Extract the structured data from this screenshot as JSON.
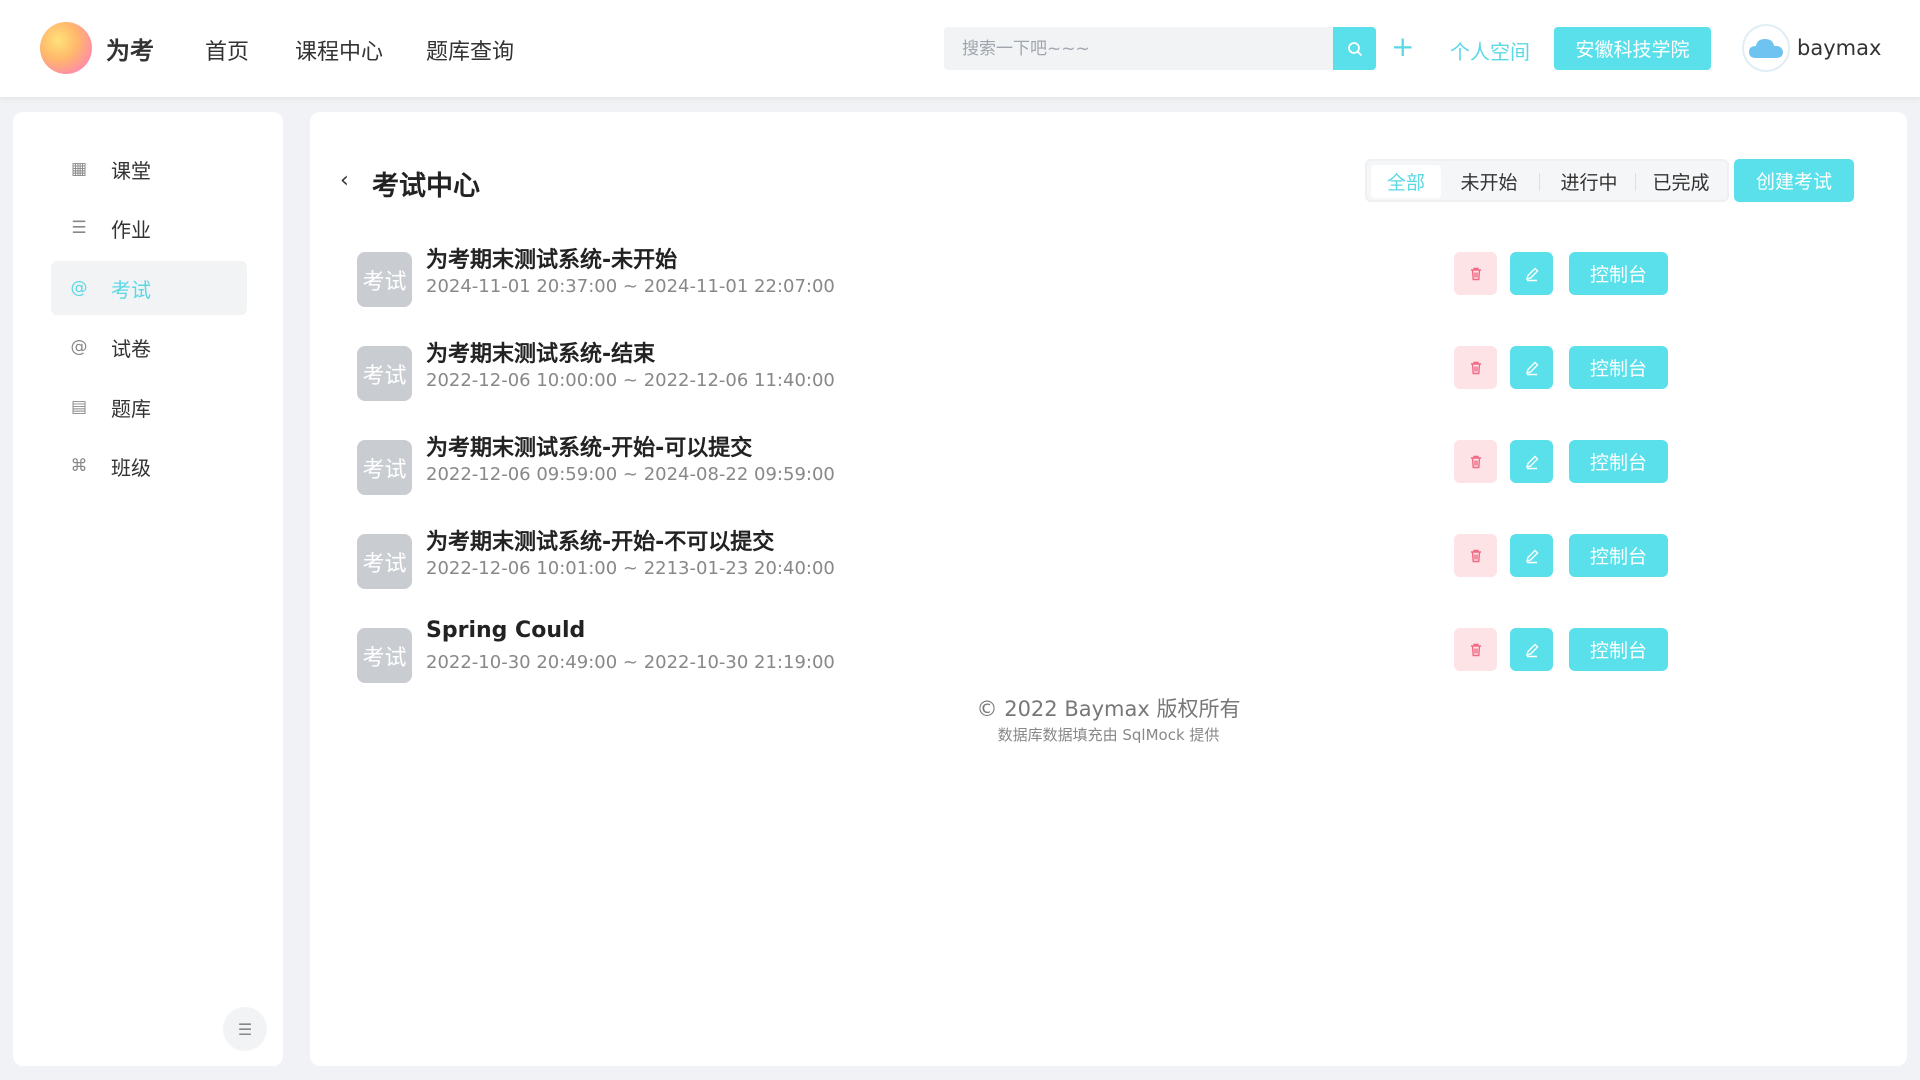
{
  "header": {
    "brand": "为考",
    "nav": [
      "首页",
      "课程中心",
      "题库查询"
    ],
    "search_placeholder": "搜索一下吧~~~",
    "plus": "+",
    "personal_space": "个人空间",
    "school": "安徽科技学院",
    "username": "baymax"
  },
  "sidebar": {
    "items": [
      {
        "label": "课堂",
        "icon": "grid-icon"
      },
      {
        "label": "作业",
        "icon": "list-icon"
      },
      {
        "label": "考试",
        "icon": "at-icon"
      },
      {
        "label": "试卷",
        "icon": "at-icon"
      },
      {
        "label": "题库",
        "icon": "doc-icon"
      },
      {
        "label": "班级",
        "icon": "command-icon"
      }
    ],
    "active_index": 2,
    "collapse_icon": "collapse-icon"
  },
  "main": {
    "back": "‹",
    "title": "考试中心",
    "filters": [
      "全部",
      "未开始",
      "进行中",
      "已完成"
    ],
    "active_filter": 0,
    "create_label": "创建考试",
    "badge_label": "考试",
    "console_label": "控制台",
    "exams": [
      {
        "title": "为考期末测试系统-未开始",
        "time": "2024-11-01 20:37:00 ~ 2024-11-01 22:07:00"
      },
      {
        "title": "为考期末测试系统-结束",
        "time": "2022-12-06 10:00:00 ~ 2022-12-06 11:40:00"
      },
      {
        "title": "为考期末测试系统-开始-可以提交",
        "time": "2022-12-06 09:59:00 ~ 2024-08-22 09:59:00"
      },
      {
        "title": "为考期末测试系统-开始-不可以提交",
        "time": "2022-12-06 10:01:00 ~ 2213-01-23 20:40:00"
      },
      {
        "title": "Spring Could",
        "time": "2022-10-30 20:49:00 ~ 2022-10-30 21:19:00"
      }
    ],
    "footer": {
      "copyright": "© 2022 Baymax 版权所有",
      "note": "数据库数据填充由 SqlMock 提供"
    }
  },
  "colors": {
    "accent": "#5ae0ea",
    "delete_bg": "#fde2e6",
    "delete_icon": "#f06b86",
    "badge_bg": "#c9cdd2"
  }
}
